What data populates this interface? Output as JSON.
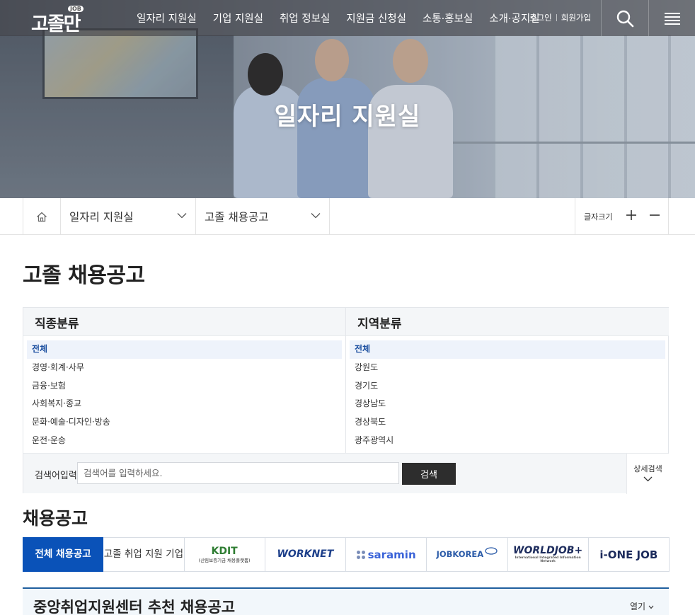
{
  "header": {
    "logo": "고졸만",
    "logo_badge": "JOB",
    "menu": [
      {
        "label": "일자리 지원실"
      },
      {
        "label": "기업 지원실"
      },
      {
        "label": "취업 정보실"
      },
      {
        "label": "지원금 신청실"
      },
      {
        "label": "소통·홍보실"
      },
      {
        "label": "소개·공지실"
      }
    ],
    "login": "로그인",
    "signup": "회원가입",
    "search_icon": "search-icon",
    "menu_icon": "hamburger-icon"
  },
  "hero": {
    "title": "일자리 지원실"
  },
  "breadcrumb": {
    "home_icon": "home-icon",
    "level1": "일자리 지원실",
    "level2": "고졸 채용공고",
    "font_size_label": "글자크기",
    "increase_icon": "plus-icon",
    "decrease_icon": "minus-icon"
  },
  "page": {
    "title": "고졸 채용공고"
  },
  "filter": {
    "job_category": {
      "heading": "직종분류",
      "options": [
        "전체",
        "경영·회계·사무",
        "금융·보험",
        "사회복지·종교",
        "문화·예술·디자인·방송",
        "운전·운송"
      ],
      "selected": "전체"
    },
    "region": {
      "heading": "지역분류",
      "options": [
        "전체",
        "강원도",
        "경기도",
        "경상남도",
        "경상북도",
        "광주광역시"
      ],
      "selected": "전체"
    },
    "search": {
      "label": "검색어입력",
      "placeholder": "검색어를 입력하세요.",
      "value": "",
      "button": "검색"
    },
    "detail_search": "상세검색"
  },
  "listings": {
    "title": "채용공고",
    "tabs": [
      {
        "label": "전체 채용공고",
        "active": true
      },
      {
        "label": "고졸 취업 지원 기업",
        "active": false
      },
      {
        "label": "KDIT",
        "sub": "(산림보증기금 채용플랫폼)",
        "active": false
      },
      {
        "label": "WORKNET",
        "active": false
      },
      {
        "label": "saramin",
        "active": false
      },
      {
        "label": "JOBKOREA",
        "active": false
      },
      {
        "label": "WORLDJOB+",
        "sub": "International Integrated Information Network",
        "active": false
      },
      {
        "label": "i-ONE JOB",
        "active": false
      }
    ]
  },
  "recommend": {
    "title": "중앙취업지원센터 추천 채용공고",
    "toggle": "열기"
  },
  "colors": {
    "accent": "#0a52b8",
    "dark_button": "#2d2d2d",
    "selected_text": "#1b4fa0"
  }
}
